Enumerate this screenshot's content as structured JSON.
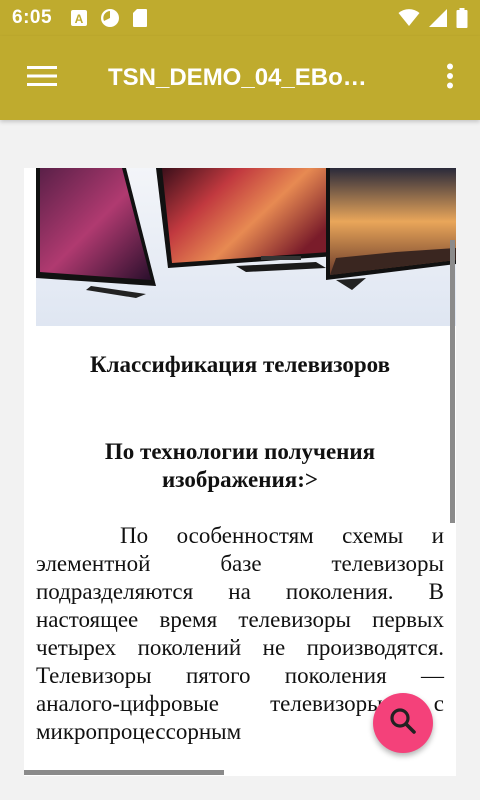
{
  "status_bar": {
    "time": "6:05",
    "left_icons": [
      "keyboard-a-icon",
      "pie-chart-icon",
      "sd-card-icon"
    ],
    "right_icons": [
      "wifi-icon",
      "cell-signal-icon",
      "battery-icon"
    ]
  },
  "app_bar": {
    "title": "TSN_DEMO_04_EBo…",
    "menu_icon": "hamburger-menu-icon",
    "more_icon": "more-vert-icon",
    "color": "#bfab2e"
  },
  "document": {
    "hero_image": "tv-lineup-image",
    "title": "Классификация телевизоров",
    "subtitle": "По технологии получения изображения:>",
    "paragraph": "По особенностям схемы и элементной базе телевизоры подразделяются на поколения. В настоящее время телевизоры первых четырех поколений не производятся. Телевизоры пятого поколения — аналого-цифровые телевизоры с микропроцессорным"
  },
  "fab": {
    "icon": "search-icon",
    "color": "#f4417a"
  }
}
